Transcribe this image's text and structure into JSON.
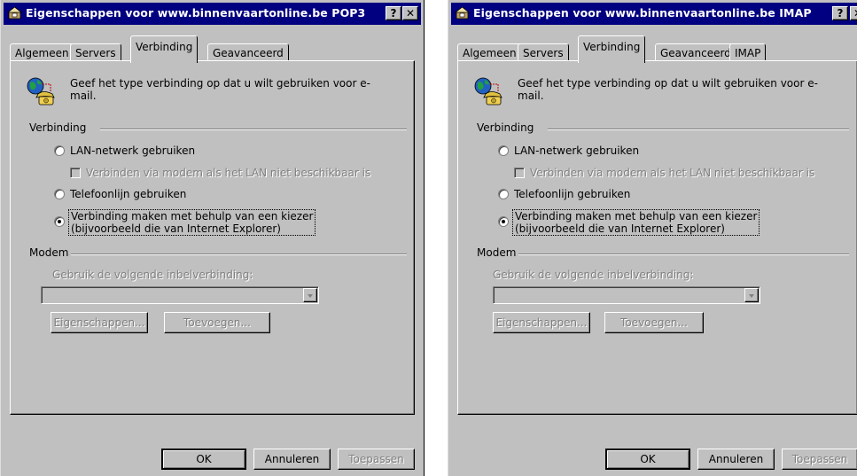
{
  "windows": [
    {
      "title": "Eigenschappen voor www.binnenvaartonline.be POP3",
      "help_label": "?",
      "close_label": "✕",
      "tabs": [
        "Algemeen",
        "Servers",
        "Verbinding",
        "Geavanceerd"
      ],
      "active_tab": "Verbinding",
      "intro_text": "Geef het type verbinding op dat u wilt gebruiken voor e-mail.",
      "group_connection": "Verbinding",
      "radio_lan": "LAN-netwerk gebruiken",
      "check_modem_fallback": "Verbinden via modem als het LAN niet beschikbaar is",
      "radio_phone": "Telefoonlijn gebruiken",
      "radio_dialer_line1": "Verbinding maken met behulp van een kiezer",
      "radio_dialer_line2": "(bijvoorbeeld die van Internet Explorer)",
      "selected_radio": "dialer",
      "group_modem": "Modem",
      "dial_label": "Gebruik de volgende inbelverbinding:",
      "dial_value": "",
      "btn_properties": "Eigenschappen...",
      "btn_add": "Toevoegen...",
      "btn_ok": "OK",
      "btn_cancel": "Annuleren",
      "btn_apply": "Toepassen"
    },
    {
      "title": "Eigenschappen voor www.binnenvaartonline.be IMAP",
      "help_label": "?",
      "close_label": "✕",
      "tabs": [
        "Algemeen",
        "Servers",
        "Verbinding",
        "Geavanceerd",
        "IMAP"
      ],
      "active_tab": "Verbinding",
      "intro_text": "Geef het type verbinding op dat u wilt gebruiken voor e-mail.",
      "group_connection": "Verbinding",
      "radio_lan": "LAN-netwerk gebruiken",
      "check_modem_fallback": "Verbinden via modem als het LAN niet beschikbaar is",
      "radio_phone": "Telefoonlijn gebruiken",
      "radio_dialer_line1": "Verbinding maken met behulp van een kiezer",
      "radio_dialer_line2": "(bijvoorbeeld die van Internet Explorer)",
      "selected_radio": "dialer",
      "group_modem": "Modem",
      "dial_label": "Gebruik de volgende inbelverbinding:",
      "dial_value": "",
      "btn_properties": "Eigenschappen...",
      "btn_add": "Toevoegen...",
      "btn_ok": "OK",
      "btn_cancel": "Annuleren",
      "btn_apply": "Toepassen"
    }
  ],
  "colors": {
    "titlebar": "#000080",
    "face": "#c0c0c0",
    "disabled_text": "#808080"
  },
  "icons": {
    "title_icon": "mail-account-icon",
    "intro_icon": "globe-phone-icon"
  }
}
